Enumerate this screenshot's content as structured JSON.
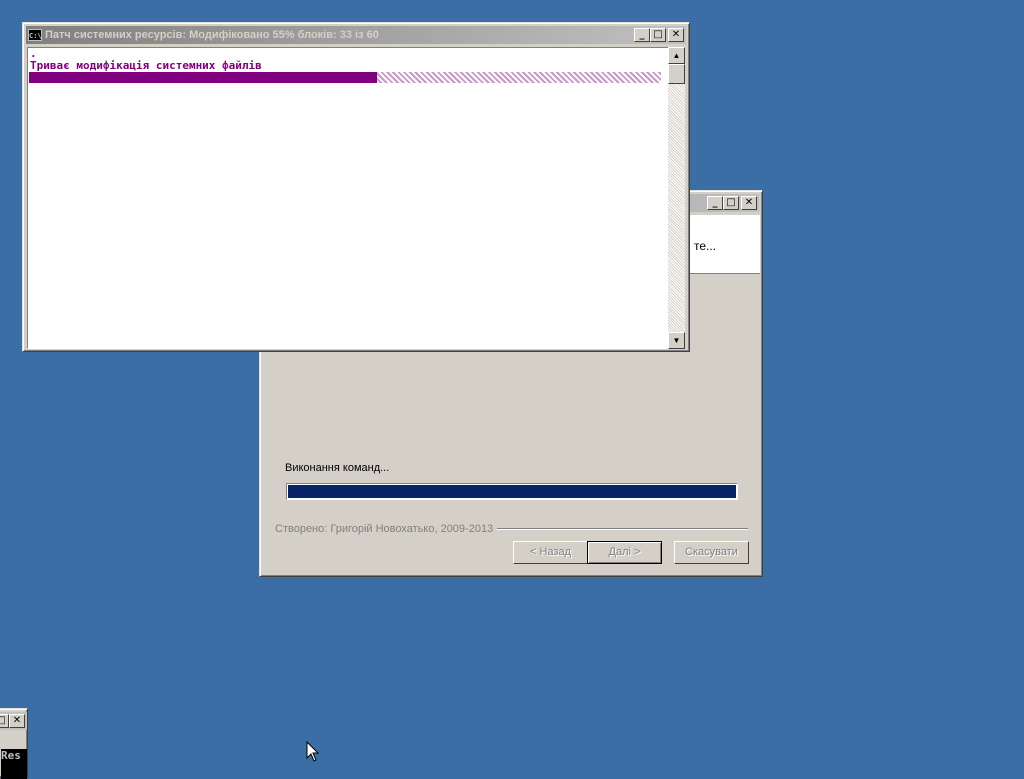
{
  "console": {
    "icon_label": "C:\\",
    "title": "Патч системних ресурсів:",
    "modified_label": "Модифіковано",
    "modified_percent": "55%",
    "blocks_label": "блоків:",
    "blocks_done": "33",
    "blocks_of": "із",
    "blocks_total": "60",
    "dot": ".",
    "message": "Триває модифікація системних файлів",
    "progress_fraction": 0.55,
    "progress_color": "#800080",
    "buttons": {
      "minimize": "_",
      "maximize": "□",
      "close": "✕"
    }
  },
  "wizard": {
    "header_text": "те...",
    "status_label": "Виконання команд...",
    "progress_fraction": 1.0,
    "progress_color": "#0a246a",
    "credit": "Створено: Григорій Новохатько, 2009-2013",
    "buttons": {
      "back": "< Назад",
      "next": "Далі >",
      "cancel": "Скасувати"
    },
    "title_buttons": {
      "minimize": "_",
      "maximize": "□",
      "close": "✕"
    }
  },
  "partial_window": {
    "title_buttons": {
      "maximize": "□",
      "close": "✕"
    },
    "body_text": "Res"
  }
}
